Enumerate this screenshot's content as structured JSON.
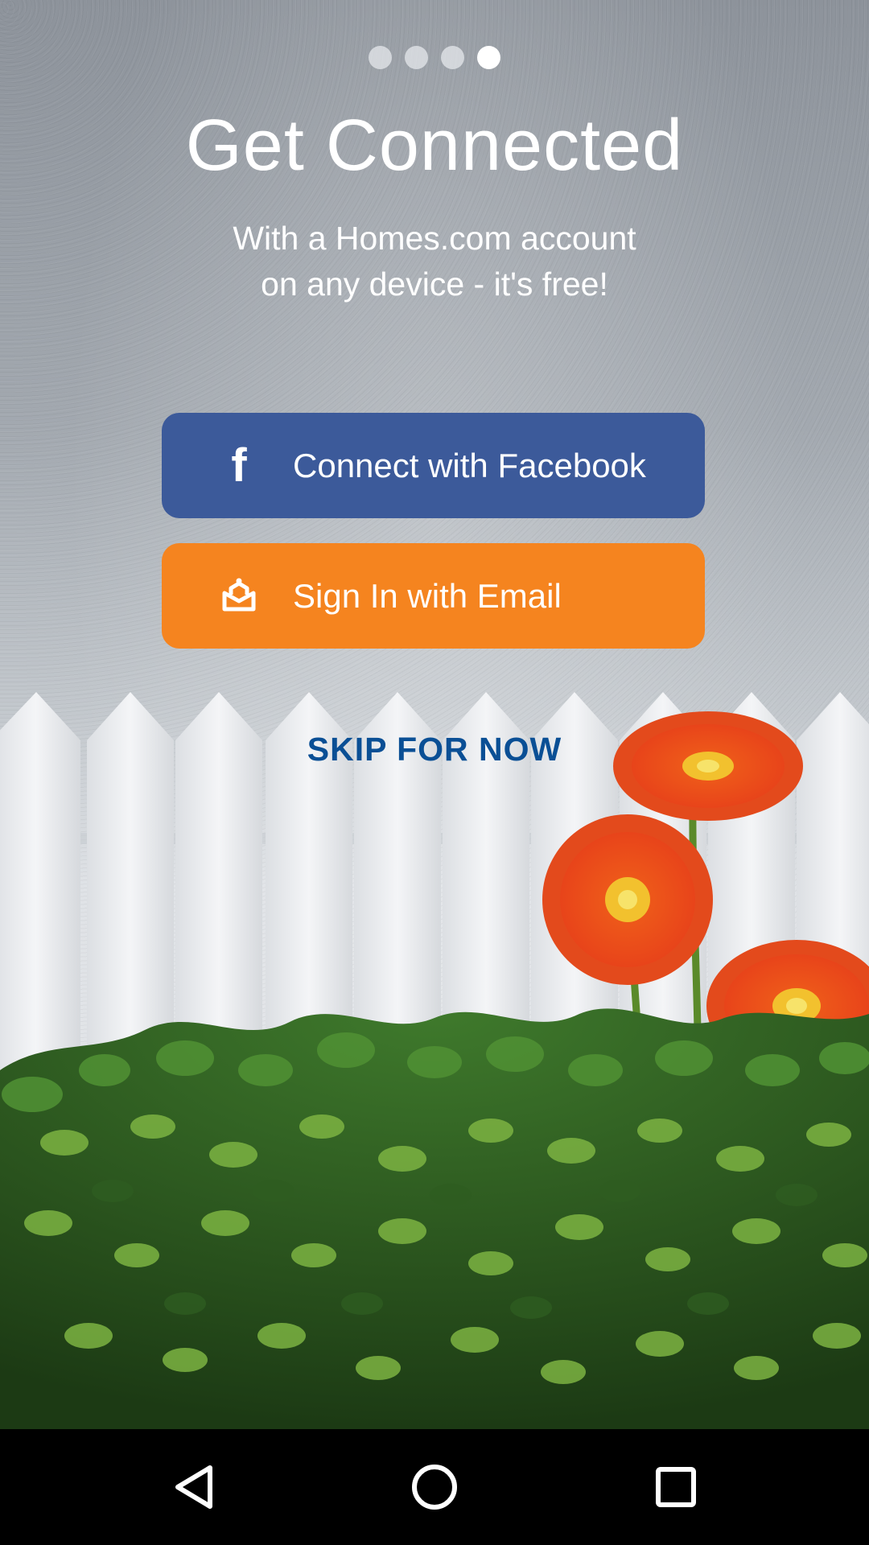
{
  "onboarding": {
    "pager": {
      "pages": 4,
      "current": 4
    },
    "title": "Get Connected",
    "subtitle_line1": "With a Homes.com account",
    "subtitle_line2": "on any device - it's free!",
    "facebook_button": {
      "label": "Connect with Facebook",
      "icon": "facebook-f-icon",
      "color": "#3c5a9a"
    },
    "email_button": {
      "label": "Sign In with Email",
      "icon": "homes-logo-icon",
      "color": "#f5841f"
    },
    "skip_label": "SKIP FOR NOW",
    "skip_color": "#0a4f95"
  },
  "navbar": {
    "back_icon": "back-triangle-icon",
    "home_icon": "home-circle-icon",
    "recents_icon": "recents-square-icon"
  }
}
